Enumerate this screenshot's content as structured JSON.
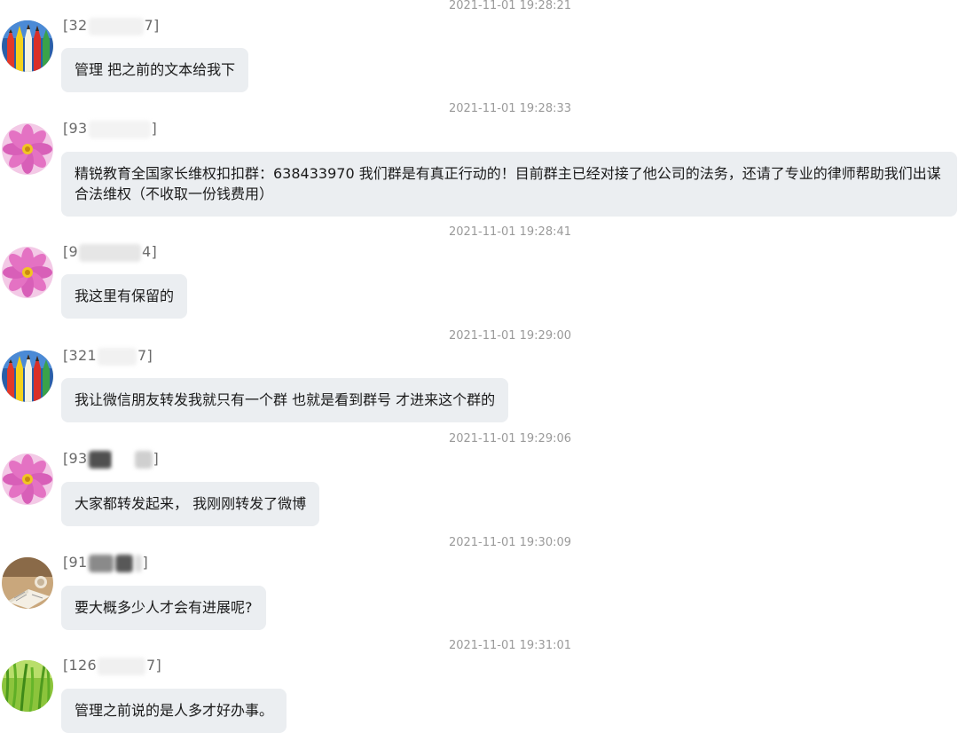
{
  "messages": [
    {
      "timestamp": "2021-11-01 19:28:21",
      "sender_open": "[32",
      "sender_close": "7]",
      "avatar": "pencils-avatar-icon",
      "text": "管理 把之前的文本给我下"
    },
    {
      "timestamp": "2021-11-01 19:28:33",
      "sender_open": "[93",
      "sender_close": "]",
      "avatar": "pink-flower-avatar-icon",
      "text": "精锐教育全国家长维权扣扣群：638433970 我们群是有真正行动的！目前群主已经对接了他公司的法务，还请了专业的律师帮助我们出谋合法维权（不收取一份钱费用）"
    },
    {
      "timestamp": "2021-11-01 19:28:41",
      "sender_open": "[9",
      "sender_close": "4]",
      "avatar": "pink-flower-avatar-icon",
      "text": "我这里有保留的"
    },
    {
      "timestamp": "2021-11-01 19:29:00",
      "sender_open": "[321",
      "sender_close": "7]",
      "avatar": "pencils-avatar-icon",
      "text": "我让微信朋友转发我就只有一个群 也就是看到群号 才进来这个群的"
    },
    {
      "timestamp": "2021-11-01 19:29:06",
      "sender_open": "[93",
      "sender_close": "]",
      "avatar": "pink-flower-avatar-icon",
      "text": "大家都转发起来， 我刚刚转发了微博"
    },
    {
      "timestamp": "2021-11-01 19:30:09",
      "sender_open": "[91",
      "sender_close": "]",
      "avatar": "book-avatar-icon",
      "text": "要大概多少人才会有进展呢?"
    },
    {
      "timestamp": "2021-11-01 19:31:01",
      "sender_open": "[126",
      "sender_close": "7]",
      "avatar": "grass-avatar-icon",
      "text": "管理之前说的是人多才好办事。"
    }
  ],
  "colors": {
    "bubble_bg": "#ebeef1",
    "timestamp": "#9a9a9a",
    "sender": "#6a6a6a"
  }
}
